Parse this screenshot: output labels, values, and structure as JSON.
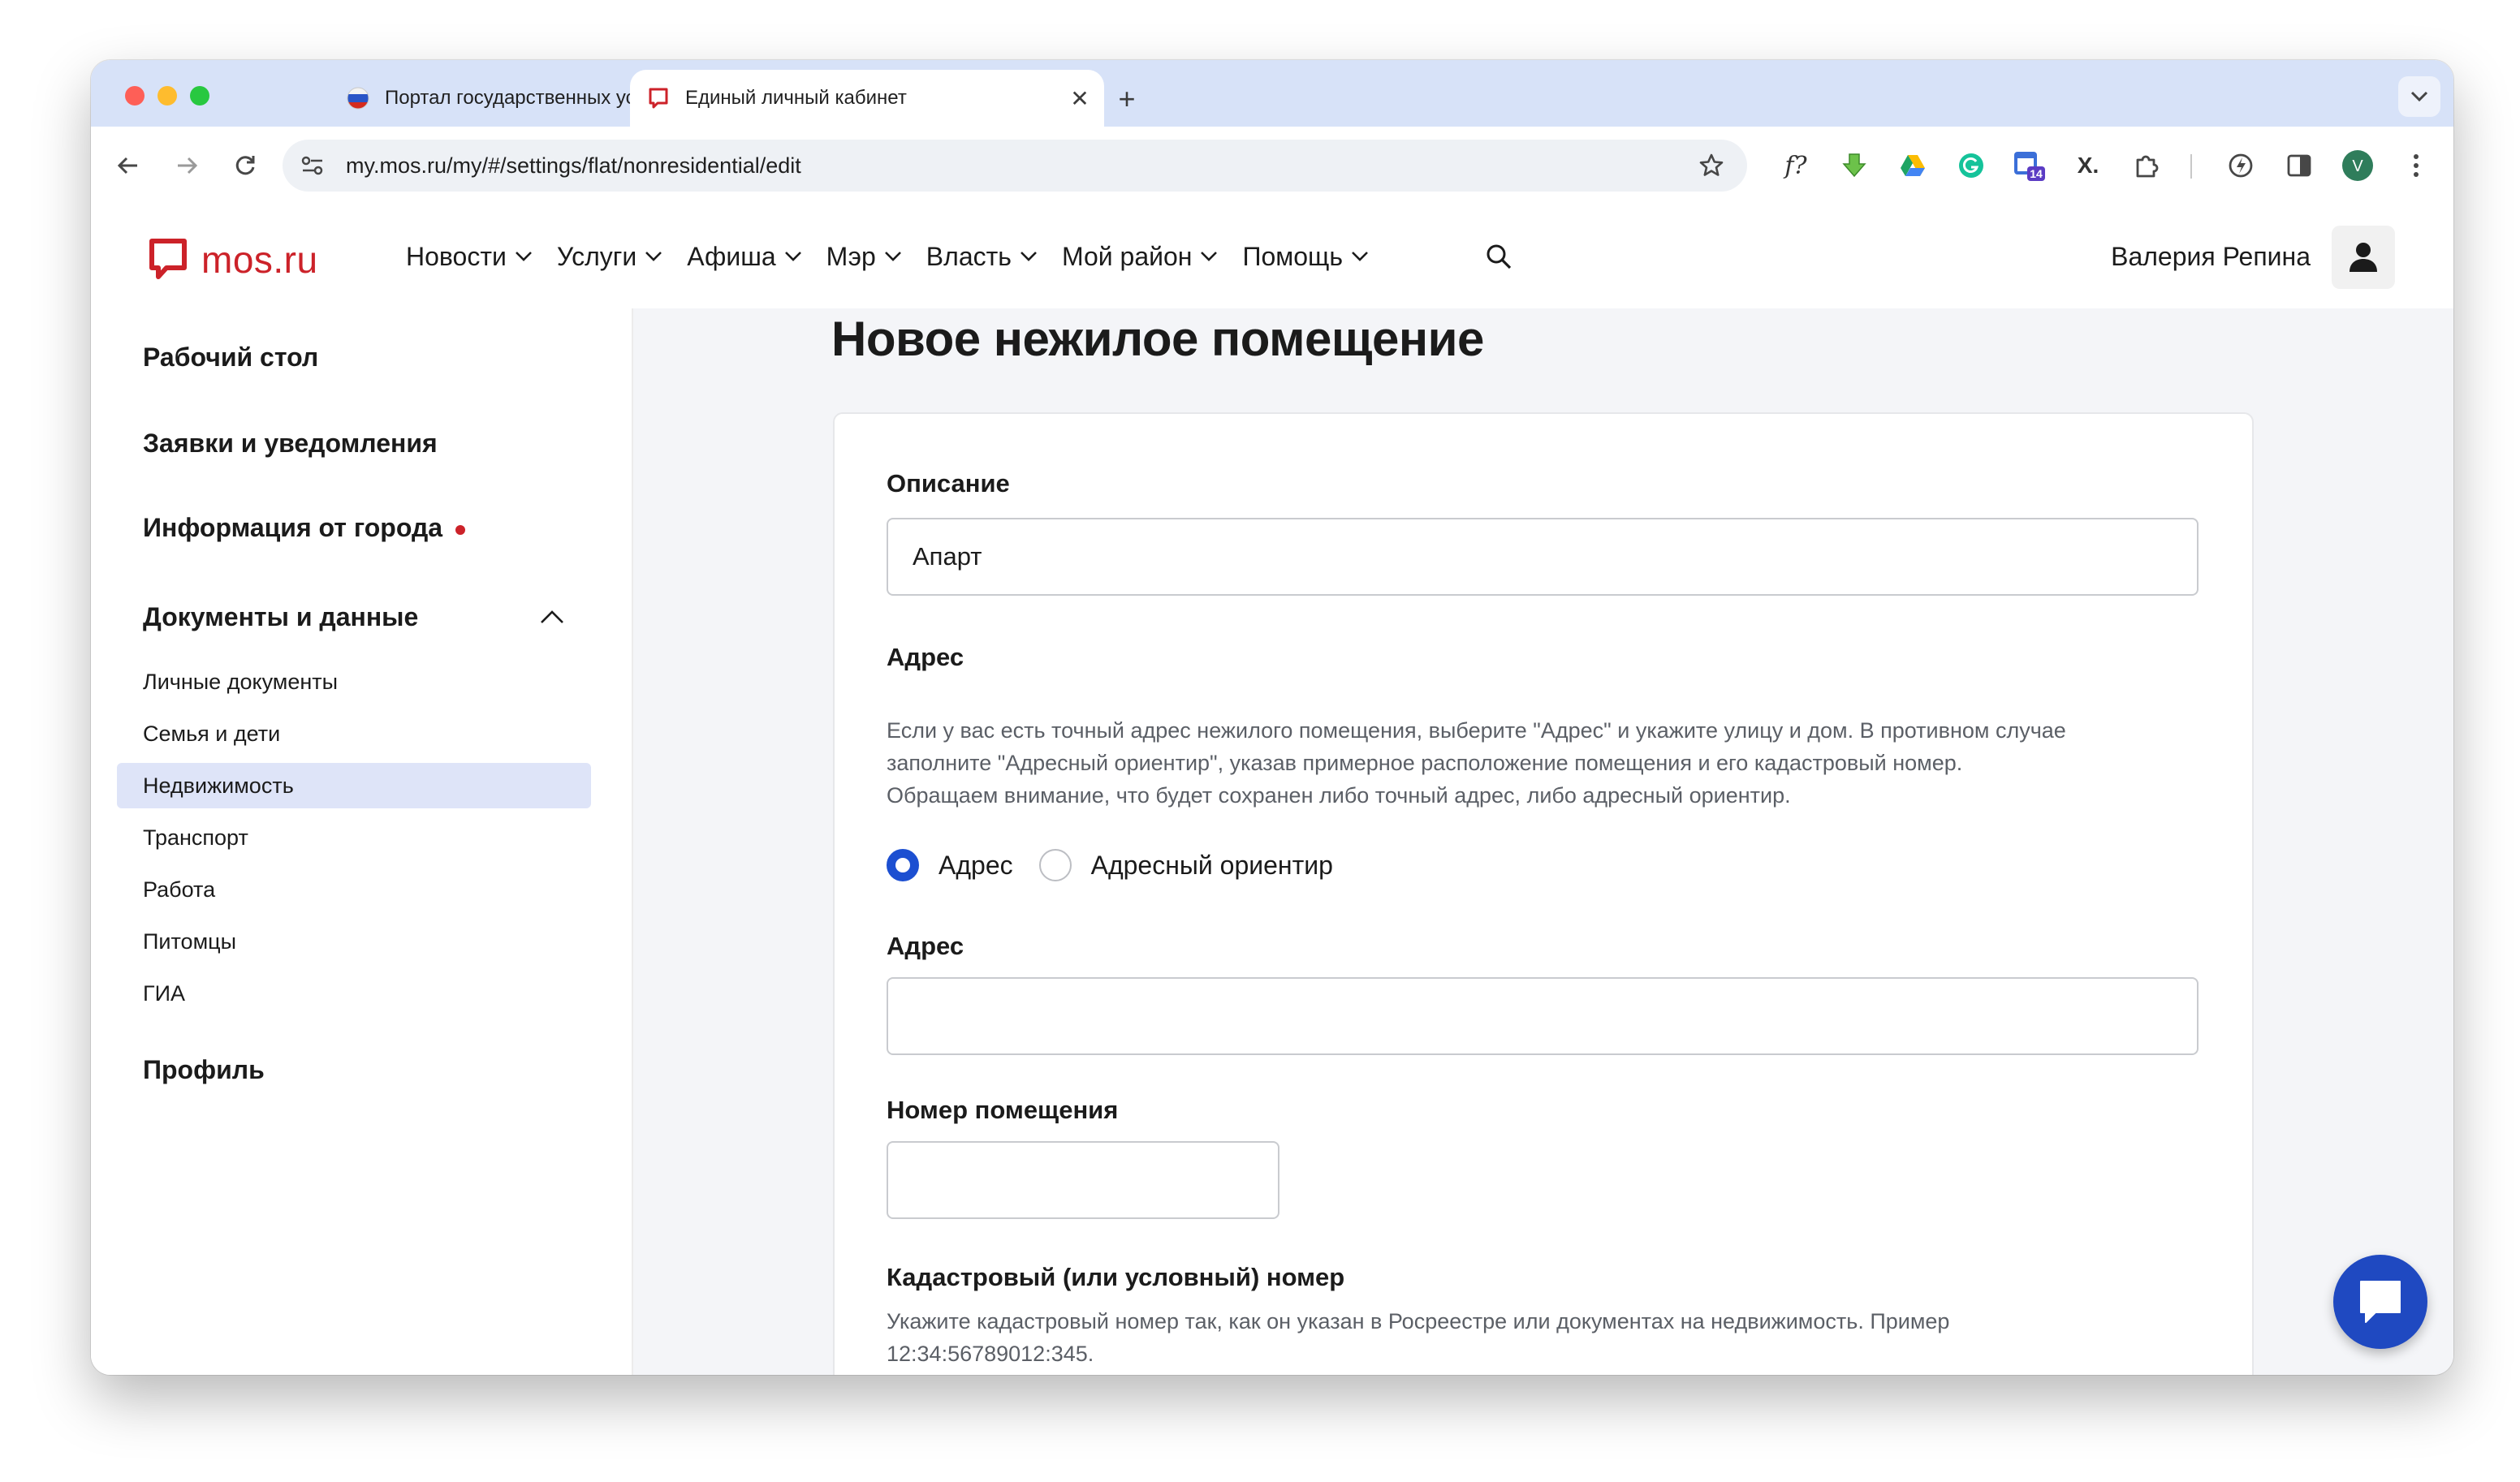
{
  "browser": {
    "tabs": [
      {
        "title": "Портал государственных ус",
        "active": false
      },
      {
        "title": "Единый личный кабинет",
        "active": true
      }
    ],
    "address_bar": {
      "url": "my.mos.ru/my/#/settings/flat/nonresidential/edit"
    },
    "extensions": [
      "function-icon",
      "download-extension-icon",
      "google-drive-icon",
      "grammarly-icon",
      "calendar-extension-icon",
      "x-extension-icon",
      "puzzle-icon",
      "performance-icon",
      "side-panel-icon",
      "profile-avatar",
      "kebab-menu-icon"
    ],
    "calendar_badge": "14",
    "profile_letter": "V"
  },
  "site": {
    "logo_text": "mos.ru",
    "nav": [
      "Новости",
      "Услуги",
      "Афиша",
      "Мэр",
      "Власть",
      "Мой район",
      "Помощь"
    ],
    "user_name": "Валерия Репина"
  },
  "sidebar": {
    "desktop": "Рабочий стол",
    "requests": "Заявки и уведомления",
    "city_info": "Информация от города",
    "documents": "Документы и данные",
    "sub_items": [
      {
        "label": "Личные документы",
        "active": false
      },
      {
        "label": "Семья и дети",
        "active": false
      },
      {
        "label": "Недвижимость",
        "active": true
      },
      {
        "label": "Транспорт",
        "active": false
      },
      {
        "label": "Работа",
        "active": false
      },
      {
        "label": "Питомцы",
        "active": false
      },
      {
        "label": "ГИА",
        "active": false
      }
    ],
    "profile": "Профиль"
  },
  "form": {
    "page_title": "Новое нежилое помещение",
    "description_label": "Описание",
    "description_value": "Апарт",
    "address_section_label": "Адрес",
    "address_hint_lines": [
      "Если у вас есть точный адрес нежилого помещения, выберите \"Адрес\" и укажите улицу и дом. В противном случае",
      "заполните \"Адресный ориентир\", указав примерное расположение помещения и его кадастровый номер.",
      "Обращаем внимание, что будет сохранен либо точный адрес, либо адресный ориентир."
    ],
    "radio_address": "Адрес",
    "radio_landmark": "Адресный ориентир",
    "selected_radio": "Адрес",
    "address_field_label": "Адрес",
    "address_field_value": "",
    "room_number_label": "Номер помещения",
    "room_number_value": "",
    "cadastral_label": "Кадастровый (или условный) номер",
    "cadastral_hint_lines": [
      "Укажите кадастровый номер так, как он указан в Росреестре или документах на недвижимость. Пример",
      "12:34:56789012:345."
    ]
  },
  "colors": {
    "brand_red": "#cc2229",
    "accent_blue": "#1c4fd1",
    "chat_blue": "#1f49c1",
    "active_nav_bg": "#dee4f8",
    "content_bg": "#f4f5f8",
    "tabstrip_bg": "#d7e2f8"
  }
}
